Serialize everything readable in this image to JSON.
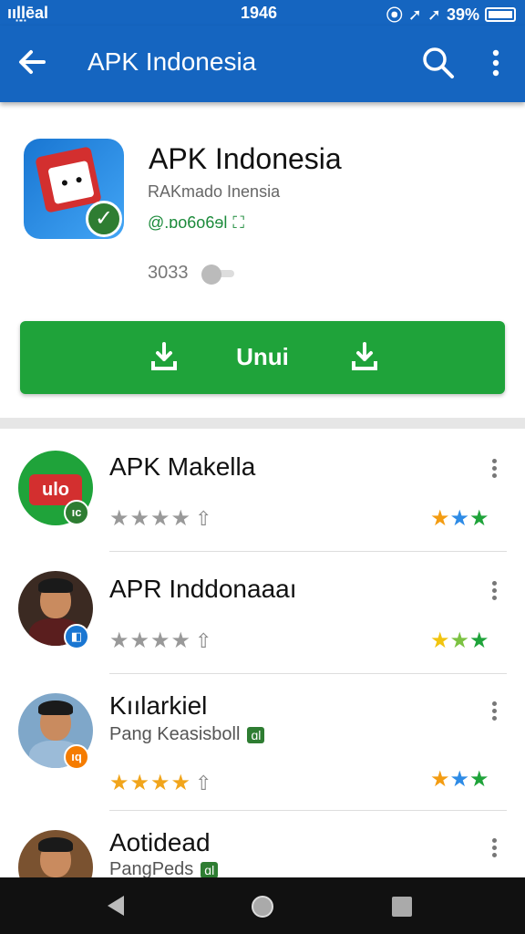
{
  "status_bar": {
    "carrier": "ııl̤l̤ēal",
    "time": "1946",
    "battery": "39%"
  },
  "app_bar": {
    "title": "APK Indonesia"
  },
  "header": {
    "app_name": "APK Indonesia",
    "subtitle": "RAKmado Inensia",
    "developer": "@.ɒo6o6ɘl",
    "count": "3033",
    "install_label": "Unui"
  },
  "list": [
    {
      "title": "APK Makella",
      "subtitle": "",
      "badge": "ıc",
      "badge_color": "#2e7d32",
      "avatar_color": "#1fa33a",
      "rating": "★★★★",
      "rating_color": "#999999"
    },
    {
      "title": "APR Inddonaaaı",
      "subtitle": "",
      "badge": "◧",
      "badge_color": "#1976d2",
      "avatar_color": "#6b3c2a",
      "rating": "★★★★",
      "rating_color": "#999999"
    },
    {
      "title": "Kıılarkiel",
      "subtitle": "Pang Keasisboll",
      "badge": "ıq",
      "badge_color": "#f57c00",
      "avatar_color": "#5d8fb8",
      "rating": "★★★★",
      "rating_color": "#f1a51c"
    },
    {
      "title": "Aotidead",
      "subtitle": "PangPeds",
      "badge": "",
      "badge_color": "#1976d2",
      "avatar_color": "#7a5230",
      "rating": "",
      "rating_color": "#999999"
    }
  ],
  "colors": {
    "primary": "#1565c0",
    "install_green": "#1fa33a",
    "star_orange": "#f39c12",
    "star_blue": "#2e8be6",
    "star_green": "#1fa33a"
  }
}
